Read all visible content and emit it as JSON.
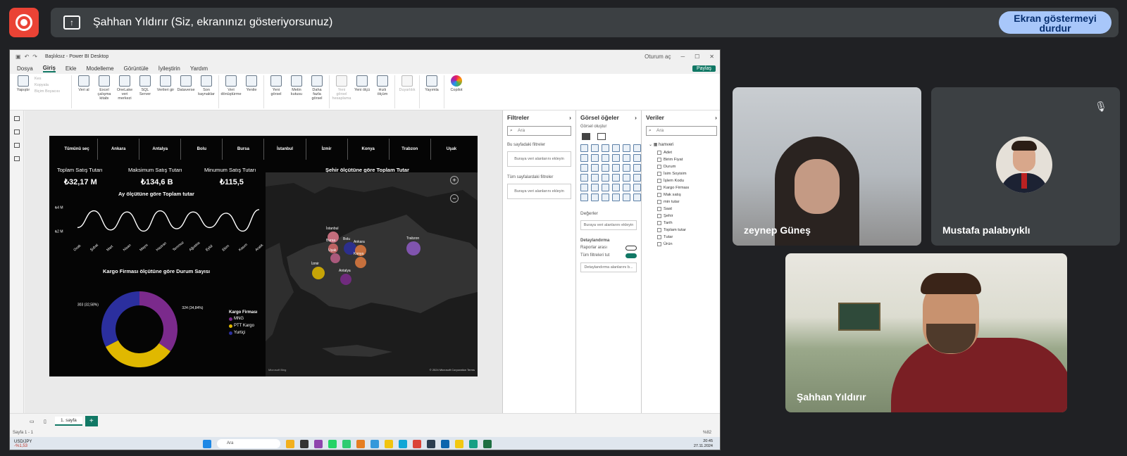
{
  "meet": {
    "presenter_text": "Şahhan Yıldırır (Siz, ekranınızı gösteriyorsunuz)",
    "stop_button": "Ekran göstermeyi durdur",
    "participants": [
      {
        "name": "zeynep Güneş"
      },
      {
        "name": "Mustafa palabıyıklı"
      },
      {
        "name": "Şahhan Yıldırır"
      }
    ]
  },
  "pbi": {
    "title": "Başlıksız - Power BI Desktop",
    "signin": "Oturum aç",
    "menu": [
      "Dosya",
      "Giriş",
      "Ekle",
      "Modelleme",
      "Görüntüle",
      "İyileştirin",
      "Yardım"
    ],
    "share": "Paylaş",
    "ribbon": {
      "paste": "Yapıştır",
      "cut": "Kes",
      "copy": "Kopyala",
      "format_painter": "Biçim Boyacısı",
      "buttons": [
        "Veri al",
        "Excel çalışma kitabı",
        "OneLake veri merkezi",
        "SQL Server",
        "Verileri gir",
        "Dataverse",
        "Son kaynaklar",
        "Veri dönüştürme",
        "Yenile",
        "Yeni görsel",
        "Metin kutusu",
        "Daha fazla görsel",
        "Yeni görsel hesaplama",
        "Yeni ölçü",
        "Hızlı ölçüm",
        "Duyarlılık",
        "Yayımla",
        "Copilot"
      ]
    },
    "report": {
      "slicers": [
        "Tümünü seç",
        "Ankara",
        "Antalya",
        "Bolu",
        "Bursa",
        "İstanbul",
        "İzmir",
        "Konya",
        "Trabzon",
        "Uşak"
      ],
      "cards": [
        {
          "label": "Toplam Satış Tutarı",
          "value": "₺32,17 M"
        },
        {
          "label": "Maksimum Satış Tutarı",
          "value": "₺134,6 B"
        },
        {
          "label": "Minumum Satış Tutarı",
          "value": "₺115,5"
        }
      ],
      "line_title": "Ay ölçütüne göre Toplam tutar",
      "donut_title": "Kargo Firması ölçütüne göre Durum Sayısı",
      "map_title": "Şehir ölçütüne göre Toplam Tutar",
      "map_labels": [
        "İstanbul",
        "Bursa",
        "Bolu",
        "Ankara",
        "Uşak",
        "İzmir",
        "Konya",
        "Antalya",
        "Trabzon"
      ],
      "map_footer_left": "Microsoft Bing",
      "map_footer_right": "© 2024 Microsoft Corporation  Terms",
      "legend_title": "Kargo Firması"
    },
    "panes": {
      "filters_title": "Filtreler",
      "visuals_title": "Görsel öğeler",
      "data_title": "Veriler",
      "search": "Ara",
      "this_page": "Bu sayfadaki filtreler",
      "all_pages": "Tüm sayfalardaki filtreler",
      "drop_here": "Buraya veri alanlarını ekleyin",
      "build_visual": "Görsel oluştur",
      "values": "Değerler",
      "drill": "Detaylandırma",
      "cross_report": "Raporlar arası",
      "keep_filters": "Tüm filtreleri tut",
      "drill_drop": "Detaylandırma alanlarını b...",
      "table": "hamveri",
      "fields": [
        "Adet",
        "Birim Fiyat",
        "Durum",
        "İsim Soyisim",
        "İşlem Kodu",
        "Kargo Firması",
        "Mak satış",
        "min tutar",
        "Saat",
        "Şehir",
        "Tarih",
        "Toplam tutar",
        "Tutar",
        "Ürün"
      ]
    },
    "page_tab": "1. sayfa",
    "status": "Sayfa 1 - 1",
    "zoom": "%82",
    "taskbar": {
      "ticker": "USD/JPY",
      "ticker_change": "-%1,53",
      "search": "Ara",
      "time": "20:45",
      "date": "27.11.2024"
    }
  },
  "chart_data": [
    {
      "type": "line",
      "title": "Ay ölçütüne göre Toplam tutar",
      "categories": [
        "Ocak",
        "Şubat",
        "Mart",
        "Nisan",
        "Mayıs",
        "Haziran",
        "Temmuz",
        "Ağustos",
        "Eylül",
        "Ekim",
        "Kasım",
        "Aralık"
      ],
      "values": [
        2.3,
        3.7,
        2.1,
        3.6,
        2.0,
        3.7,
        2.2,
        3.6,
        2.3,
        3.5,
        2.0,
        3.8
      ],
      "ylabel": "",
      "yticks": [
        "₺4 M",
        "₺2 M"
      ]
    },
    {
      "type": "pie",
      "title": "Kargo Firması ölçütüne göre Durum Sayısı",
      "donut": true,
      "series": [
        {
          "name": "MNG",
          "value": 324,
          "label": "324 (34,84%)",
          "color": "#7b2a8c"
        },
        {
          "name": "PTT Kargo",
          "value": 303,
          "label": "303 (32,58%)",
          "color": "#e0b800"
        },
        {
          "name": "Yurtiçi",
          "value": 303,
          "label": "303 (32,58%)",
          "color": "#2b2f9e"
        }
      ]
    }
  ]
}
